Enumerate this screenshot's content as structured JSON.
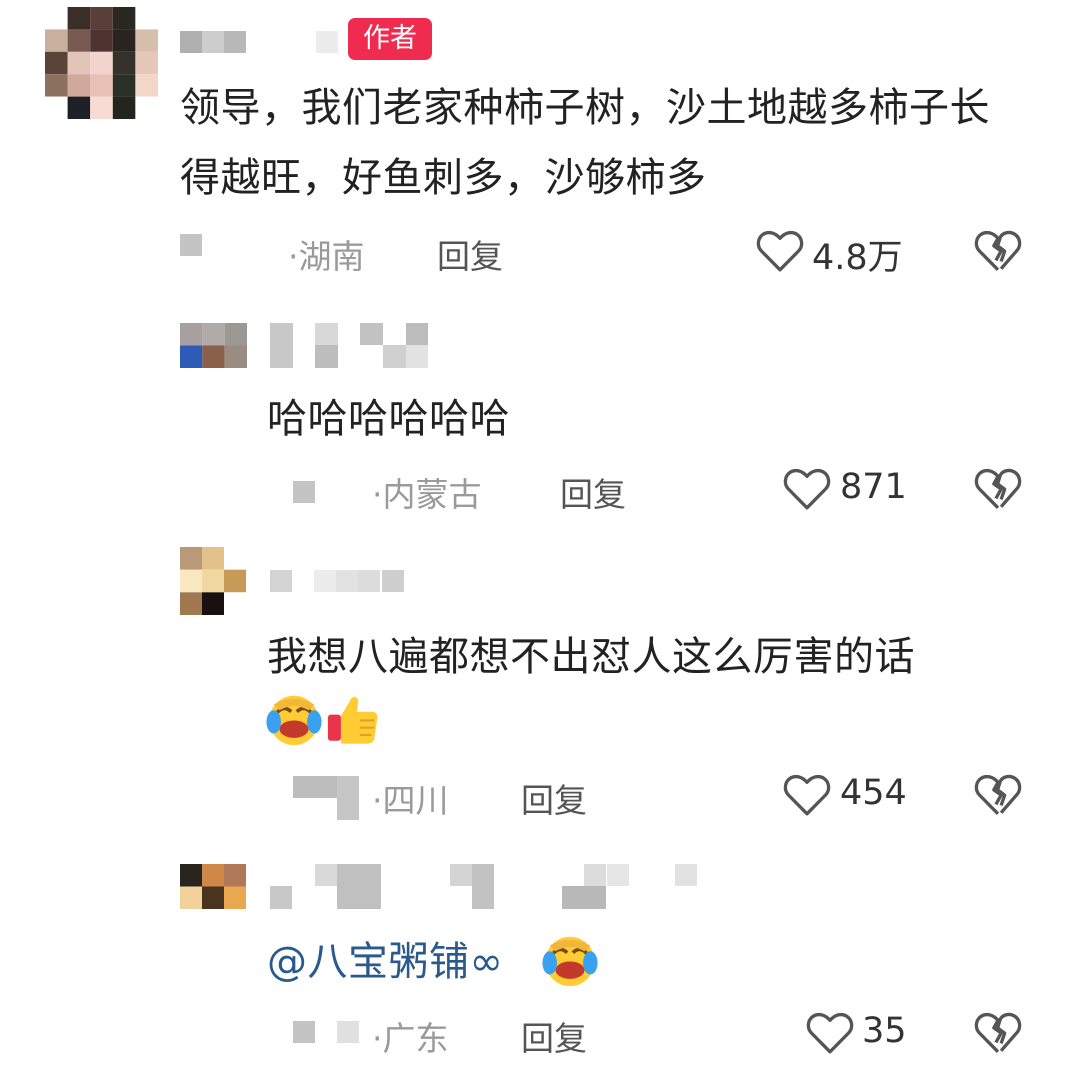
{
  "comments": [
    {
      "author_badge": "作者",
      "text": "领导，我们老家种柿子树，沙土地越多柿子长得越旺，好鱼刺多，沙够柿多",
      "location": "湖南",
      "reply_label": "回复",
      "likes": "4.8万"
    },
    {
      "text": "哈哈哈哈哈哈",
      "location": "内蒙古",
      "reply_label": "回复",
      "likes": "871"
    },
    {
      "text": "我想八遍都想不出怼人这么厉害的话",
      "location": "四川",
      "reply_label": "回复",
      "likes": "454"
    },
    {
      "mention": "@八宝粥铺∞",
      "location": "广东",
      "reply_label": "回复",
      "likes": "35"
    }
  ],
  "colors": {
    "badge": "#ef2b4f",
    "mention": "#2a5a8c",
    "muted": "#9a9a9a"
  },
  "icons": [
    "heart-outline-icon",
    "broken-heart-icon",
    "laugh-cry-emoji",
    "thumbs-up-emoji"
  ]
}
